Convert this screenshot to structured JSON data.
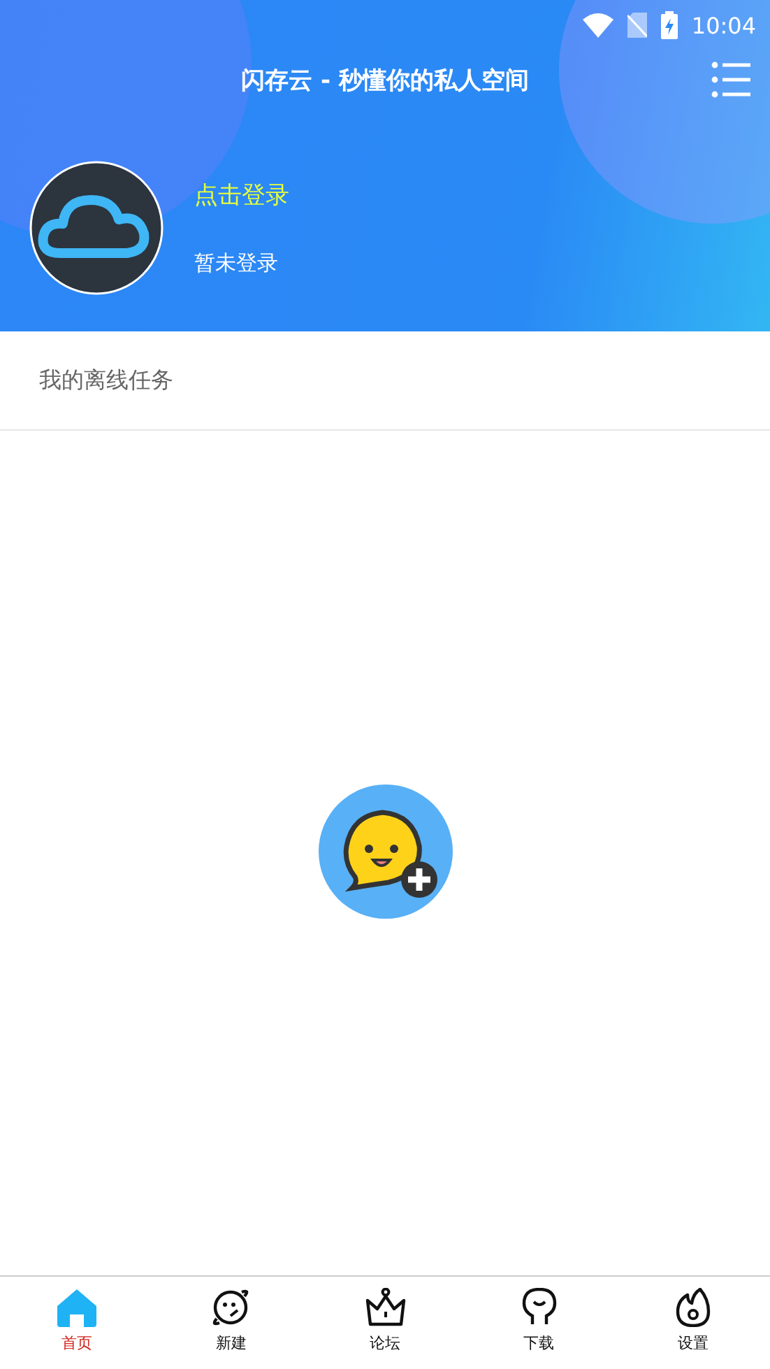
{
  "status_bar": {
    "time": "10:04"
  },
  "header": {
    "title": "闪存云 - 秒懂你的私人空间",
    "login_link": "点击登录",
    "login_status": "暂未登录"
  },
  "section": {
    "title": "我的离线任务"
  },
  "nav": [
    {
      "kind": "home",
      "label": "首页",
      "selected": true
    },
    {
      "kind": "planet",
      "label": "新建",
      "selected": false
    },
    {
      "kind": "crown",
      "label": "论坛",
      "selected": false
    },
    {
      "kind": "bulb",
      "label": "下载",
      "selected": false
    },
    {
      "kind": "flame",
      "label": "设置",
      "selected": false
    }
  ]
}
